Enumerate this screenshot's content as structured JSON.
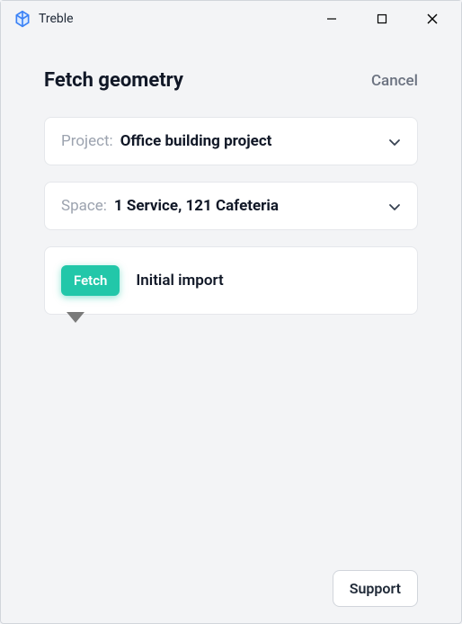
{
  "window": {
    "title": "Treble"
  },
  "page": {
    "title": "Fetch geometry",
    "cancel": "Cancel"
  },
  "project": {
    "label": "Project:",
    "value": "Office building project"
  },
  "space": {
    "label": "Space:",
    "value": "1 Service, 121 Cafeteria"
  },
  "fetch": {
    "button": "Fetch",
    "label": "Initial import"
  },
  "support": {
    "label": "Support"
  }
}
